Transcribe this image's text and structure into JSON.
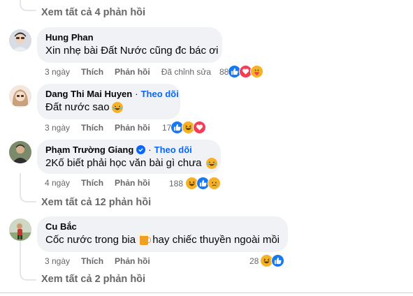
{
  "top_view_replies": "Xem tất cả 4 phản hồi",
  "comments": [
    {
      "author": "Hung Phan",
      "follow": "",
      "text": "Xin nhẹ bài Đất Nước cũng đc bác ơi",
      "time": "3 ngày",
      "like": "Thích",
      "reply": "Phản hồi",
      "edited": "Đã chỉnh sửa",
      "reaction_count": "88",
      "reactions": [
        "like-icon",
        "love-icon",
        "care-icon"
      ]
    },
    {
      "author": "Dang Thi Mai Huyen",
      "follow": "Theo dõi",
      "text": "Đất nước sao",
      "text_emoji": "rofl-emoji",
      "time": "3 ngày",
      "like": "Thích",
      "reply": "Phản hồi",
      "reaction_count": "17",
      "reactions": [
        "like-icon",
        "haha-icon",
        "love-icon"
      ]
    },
    {
      "author": "Phạm Trường Giang",
      "follow": "Theo dõi",
      "verified": true,
      "text": "2Kố biết phải học văn bài gì chưa",
      "text_emoji": "rofl-emoji",
      "time": "4 ngày",
      "like": "Thích",
      "reply": "Phản hồi",
      "reaction_count": "188",
      "reactions": [
        "haha-icon",
        "like-icon",
        "sad-icon"
      ],
      "view_replies": "Xem tất cả 12 phản hồi"
    },
    {
      "author": "Cu Bắc",
      "follow": "",
      "text_before": "Cốc nước trong bia",
      "text_after": "hay chiếc thuyền ngoài mồi",
      "text_emoji": "beer-emoji",
      "time": "3 ngày",
      "like": "Thích",
      "reply": "Phản hồi",
      "reaction_count": "28",
      "reactions": [
        "haha-icon",
        "like-icon"
      ],
      "view_replies": "Xem tất cả 2 phản hồi"
    }
  ],
  "colors": {
    "bubble": "#f0f2f5",
    "secondary_text": "#65676b",
    "link_blue": "#0866ff",
    "like_blue": "#1877f2",
    "love_red": "#f33e58",
    "emoji_yellow": "#f7b125"
  }
}
